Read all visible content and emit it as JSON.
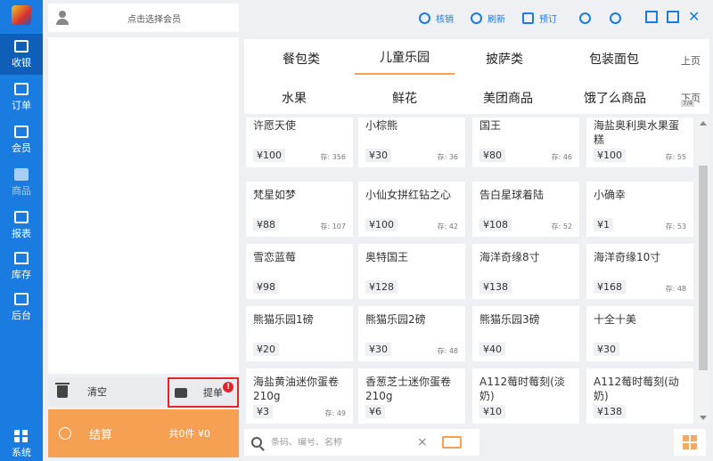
{
  "nav": {
    "items": [
      {
        "label": "收银",
        "icon": "cashier-icon"
      },
      {
        "label": "订单",
        "icon": "order-icon"
      },
      {
        "label": "会员",
        "icon": "member-icon"
      },
      {
        "label": "商品",
        "icon": "goods-icon"
      },
      {
        "label": "报表",
        "icon": "report-icon"
      },
      {
        "label": "库存",
        "icon": "inventory-icon"
      },
      {
        "label": "后台",
        "icon": "backend-icon"
      },
      {
        "label": "系统",
        "icon": "system-icon"
      }
    ]
  },
  "member": {
    "label": "点击选择会员"
  },
  "toolbar": {
    "verify": "核销",
    "refresh": "刷新",
    "reserve": "预订"
  },
  "order": {
    "clear_label": "清空",
    "pick_label": "提单",
    "pick_badge": "!",
    "checkout_label": "结算",
    "summary": "共0件 ¥0"
  },
  "categories": {
    "row1": [
      "餐包类",
      "儿童乐园",
      "披萨类",
      "包装面包"
    ],
    "row2": [
      "水果",
      "鲜花",
      "美团商品",
      "饿了么商品"
    ],
    "active": "儿童乐园",
    "prev": "上页",
    "next": "下页",
    "page": "7/4"
  },
  "products": [
    {
      "name": "许愿天使",
      "price": "¥100",
      "stock": "存: 356"
    },
    {
      "name": "小棕熊",
      "price": "¥30",
      "stock": "存: 36"
    },
    {
      "name": "国王",
      "price": "¥80",
      "stock": "存: 46"
    },
    {
      "name": "海盐奥利奥水果蛋糕",
      "price": "¥100",
      "stock": "存: 55"
    },
    {
      "name": "梵星如梦",
      "price": "¥88",
      "stock": "存: 107"
    },
    {
      "name": "小仙女拼红钻之心",
      "price": "¥100",
      "stock": "存: 42"
    },
    {
      "name": "告白星球着陆",
      "price": "¥108",
      "stock": "存: 52"
    },
    {
      "name": "小确幸",
      "price": "¥1",
      "stock": "存: 53"
    },
    {
      "name": "雪恋蓝莓",
      "price": "¥98",
      "stock": ""
    },
    {
      "name": "奥特国王",
      "price": "¥128",
      "stock": ""
    },
    {
      "name": "海洋奇缘8寸",
      "price": "¥138",
      "stock": ""
    },
    {
      "name": "海洋奇缘10寸",
      "price": "¥168",
      "stock": "存: 48"
    },
    {
      "name": "熊猫乐园1磅",
      "price": "¥20",
      "stock": ""
    },
    {
      "name": "熊猫乐园2磅",
      "price": "¥30",
      "stock": "存: 48"
    },
    {
      "name": "熊猫乐园3磅",
      "price": "¥40",
      "stock": ""
    },
    {
      "name": "十全十美",
      "price": "¥30",
      "stock": ""
    },
    {
      "name": "海盐黄油迷你蛋卷210g",
      "price": "¥3",
      "stock": "存: 49"
    },
    {
      "name": "香葱芝士迷你蛋卷210g",
      "price": "¥6",
      "stock": ""
    },
    {
      "name": "A112莓时莓刻(淡奶)",
      "price": "¥10",
      "stock": ""
    },
    {
      "name": "A112莓时莓刻(动奶)",
      "price": "¥138",
      "stock": ""
    }
  ],
  "search": {
    "placeholder": "条码、编号、名称",
    "clear": "×"
  },
  "colors": {
    "nav_blue": "#1a7be0",
    "accent_orange": "#f5a052",
    "alert_red": "#e0262b"
  }
}
